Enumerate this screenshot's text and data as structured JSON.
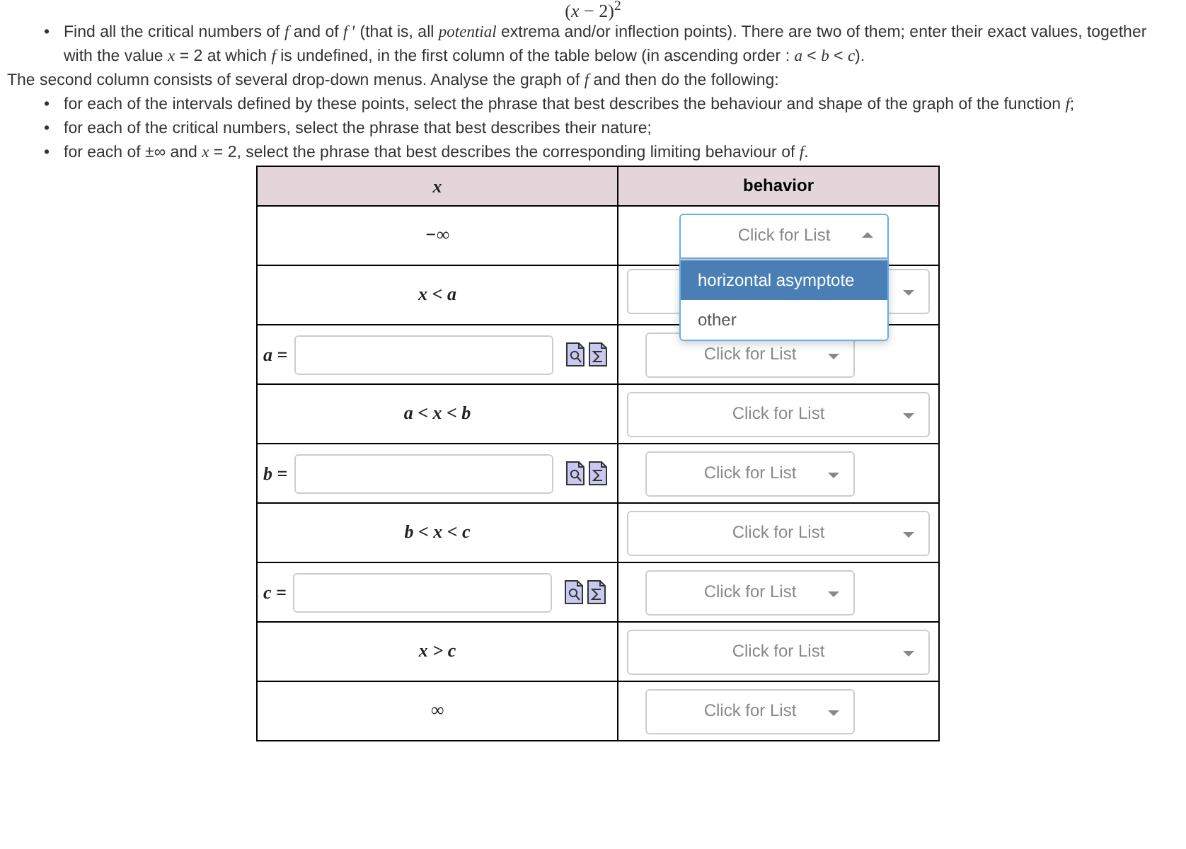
{
  "formula_fragment": "(*x* − 2)$^{2}$",
  "bullet": "•",
  "instructions": [
    "Find all the critical numbers of *f* and of *f* ′ (that is, all *potential* extrema and/or inflection points).  There are two of them; enter their exact values, together with the value *x* = 2 at which *f* is undefined, in the first column of the table below (in ascending order : *a* < *b* < *c*)."
  ],
  "paragraph": "The second column consists of several drop-down menus.  Analyse the graph of *f* and then do the following:",
  "tasks": [
    "for each of the intervals defined by these points, select the phrase that best describes the behaviour and shape of the graph of the function *f*;",
    "for each of the critical numbers, select the phrase that best describes their nature;",
    "for each of ±∞ and *x* = 2, select the phrase that best describes the corresponding limiting behaviour of *f*."
  ],
  "table": {
    "columns": [
      "x",
      "behavior"
    ],
    "rows": [
      {
        "kind": "limit",
        "label": "−∞",
        "select": {
          "placeholder": "Click for List",
          "expanded": true,
          "options": [
            {
              "label": "horizontal asymptote",
              "selected": true
            },
            {
              "label": "other",
              "selected": false
            }
          ]
        }
      },
      {
        "kind": "interval",
        "label": "x < a",
        "select": {
          "expanded": false
        }
      },
      {
        "kind": "point",
        "label": "a =",
        "select": {
          "placeholder": "Click for List",
          "expanded": false
        }
      },
      {
        "kind": "interval",
        "label": "a < x < b",
        "select": {
          "placeholder": "Click for List",
          "expanded": false
        }
      },
      {
        "kind": "point",
        "label": "b =",
        "select": {
          "placeholder": "Click for List",
          "expanded": false
        }
      },
      {
        "kind": "interval",
        "label": "b < x < c",
        "select": {
          "placeholder": "Click for List",
          "expanded": false
        }
      },
      {
        "kind": "point",
        "label": "c =",
        "select": {
          "placeholder": "Click for List",
          "expanded": false
        }
      },
      {
        "kind": "interval",
        "label": "x > c",
        "select": {
          "placeholder": "Click for List",
          "expanded": false
        }
      },
      {
        "kind": "limit",
        "label": "∞",
        "select": {
          "placeholder": "Click for List",
          "expanded": false
        }
      }
    ]
  }
}
